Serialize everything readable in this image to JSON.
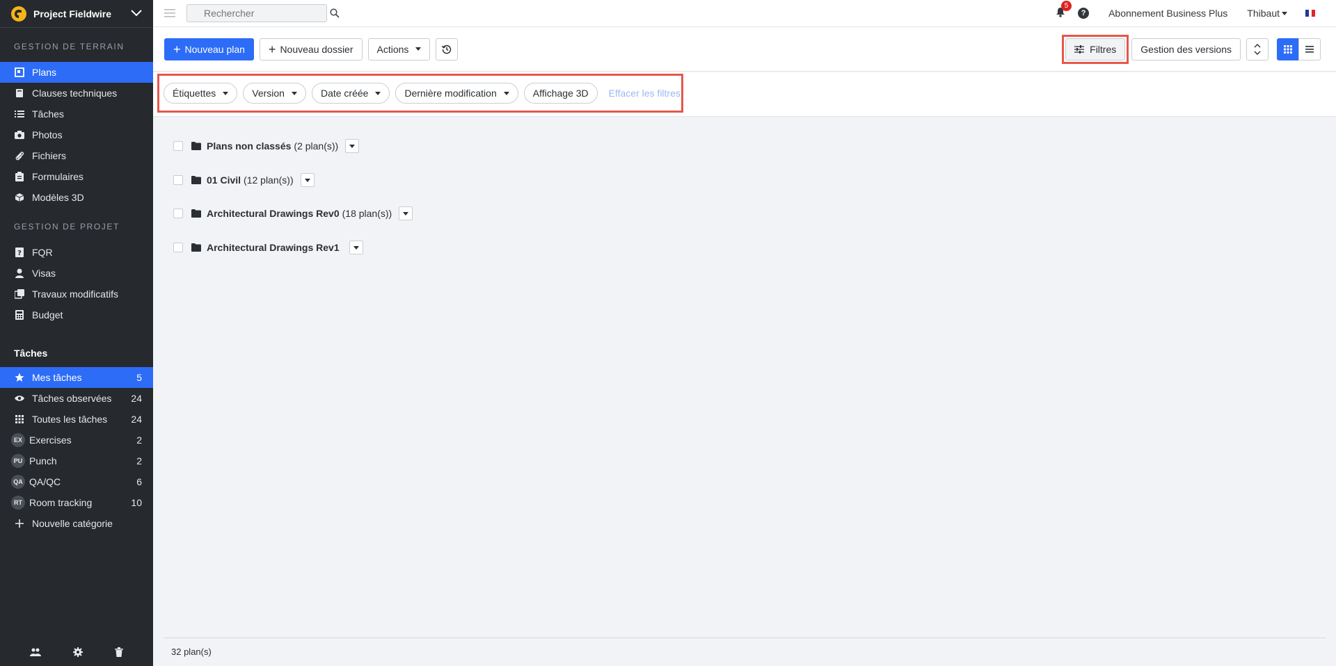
{
  "project": {
    "name": "Project Fieldwire"
  },
  "sidebar": {
    "section_terrain": "GESTION DE TERRAIN",
    "terrain_items": [
      {
        "label": "Plans",
        "icon": "plans-icon",
        "active": true
      },
      {
        "label": "Clauses techniques",
        "icon": "book-icon"
      },
      {
        "label": "Tâches",
        "icon": "list-icon"
      },
      {
        "label": "Photos",
        "icon": "camera-icon"
      },
      {
        "label": "Fichiers",
        "icon": "paperclip-icon"
      },
      {
        "label": "Formulaires",
        "icon": "clipboard-icon"
      },
      {
        "label": "Modèles 3D",
        "icon": "cube-icon"
      }
    ],
    "section_projet": "GESTION DE PROJET",
    "projet_items": [
      {
        "label": "FQR",
        "icon": "question-doc-icon"
      },
      {
        "label": "Visas",
        "icon": "person-icon"
      },
      {
        "label": "Travaux modificatifs",
        "icon": "change-order-icon"
      },
      {
        "label": "Budget",
        "icon": "calculator-icon"
      }
    ],
    "tasks_title": "Tâches",
    "task_items": [
      {
        "label": "Mes tâches",
        "count": "5",
        "icon": "star-icon",
        "active": true
      },
      {
        "label": "Tâches observées",
        "count": "24",
        "icon": "eye-icon"
      },
      {
        "label": "Toutes les tâches",
        "count": "24",
        "icon": "grid-icon"
      },
      {
        "label": "Exercises",
        "count": "2",
        "badge": "EX"
      },
      {
        "label": "Punch",
        "count": "2",
        "badge": "PU"
      },
      {
        "label": "QA/QC",
        "count": "6",
        "badge": "QA"
      },
      {
        "label": "Room tracking",
        "count": "10",
        "badge": "RT"
      },
      {
        "label": "Nouvelle catégorie",
        "icon": "plus-icon"
      }
    ]
  },
  "topbar": {
    "search_placeholder": "Rechercher",
    "notifications": "5",
    "help": "?",
    "subscription": "Abonnement Business Plus",
    "user": "Thibaut"
  },
  "toolbar": {
    "new_plan": "Nouveau plan",
    "new_folder": "Nouveau dossier",
    "actions": "Actions",
    "filters": "Filtres",
    "versions": "Gestion des versions"
  },
  "filters": {
    "tags": "Étiquettes",
    "version": "Version",
    "date_created": "Date créée",
    "last_modified": "Dernière modification",
    "view_3d": "Affichage 3D",
    "clear": "Effacer les filtres"
  },
  "folders": [
    {
      "name": "Plans non classés",
      "count": "(2 plan(s))"
    },
    {
      "name": "01 Civil",
      "count": "(12 plan(s))"
    },
    {
      "name": "Architectural Drawings Rev0",
      "count": "(18 plan(s))"
    },
    {
      "name": "Architectural Drawings Rev1",
      "count": ""
    }
  ],
  "footer": {
    "total": "32 plan(s)"
  },
  "colors": {
    "accent": "#2d6cf6",
    "sidebar_bg": "#26292d",
    "highlight": "#e5574b",
    "badge": "#e02020"
  }
}
